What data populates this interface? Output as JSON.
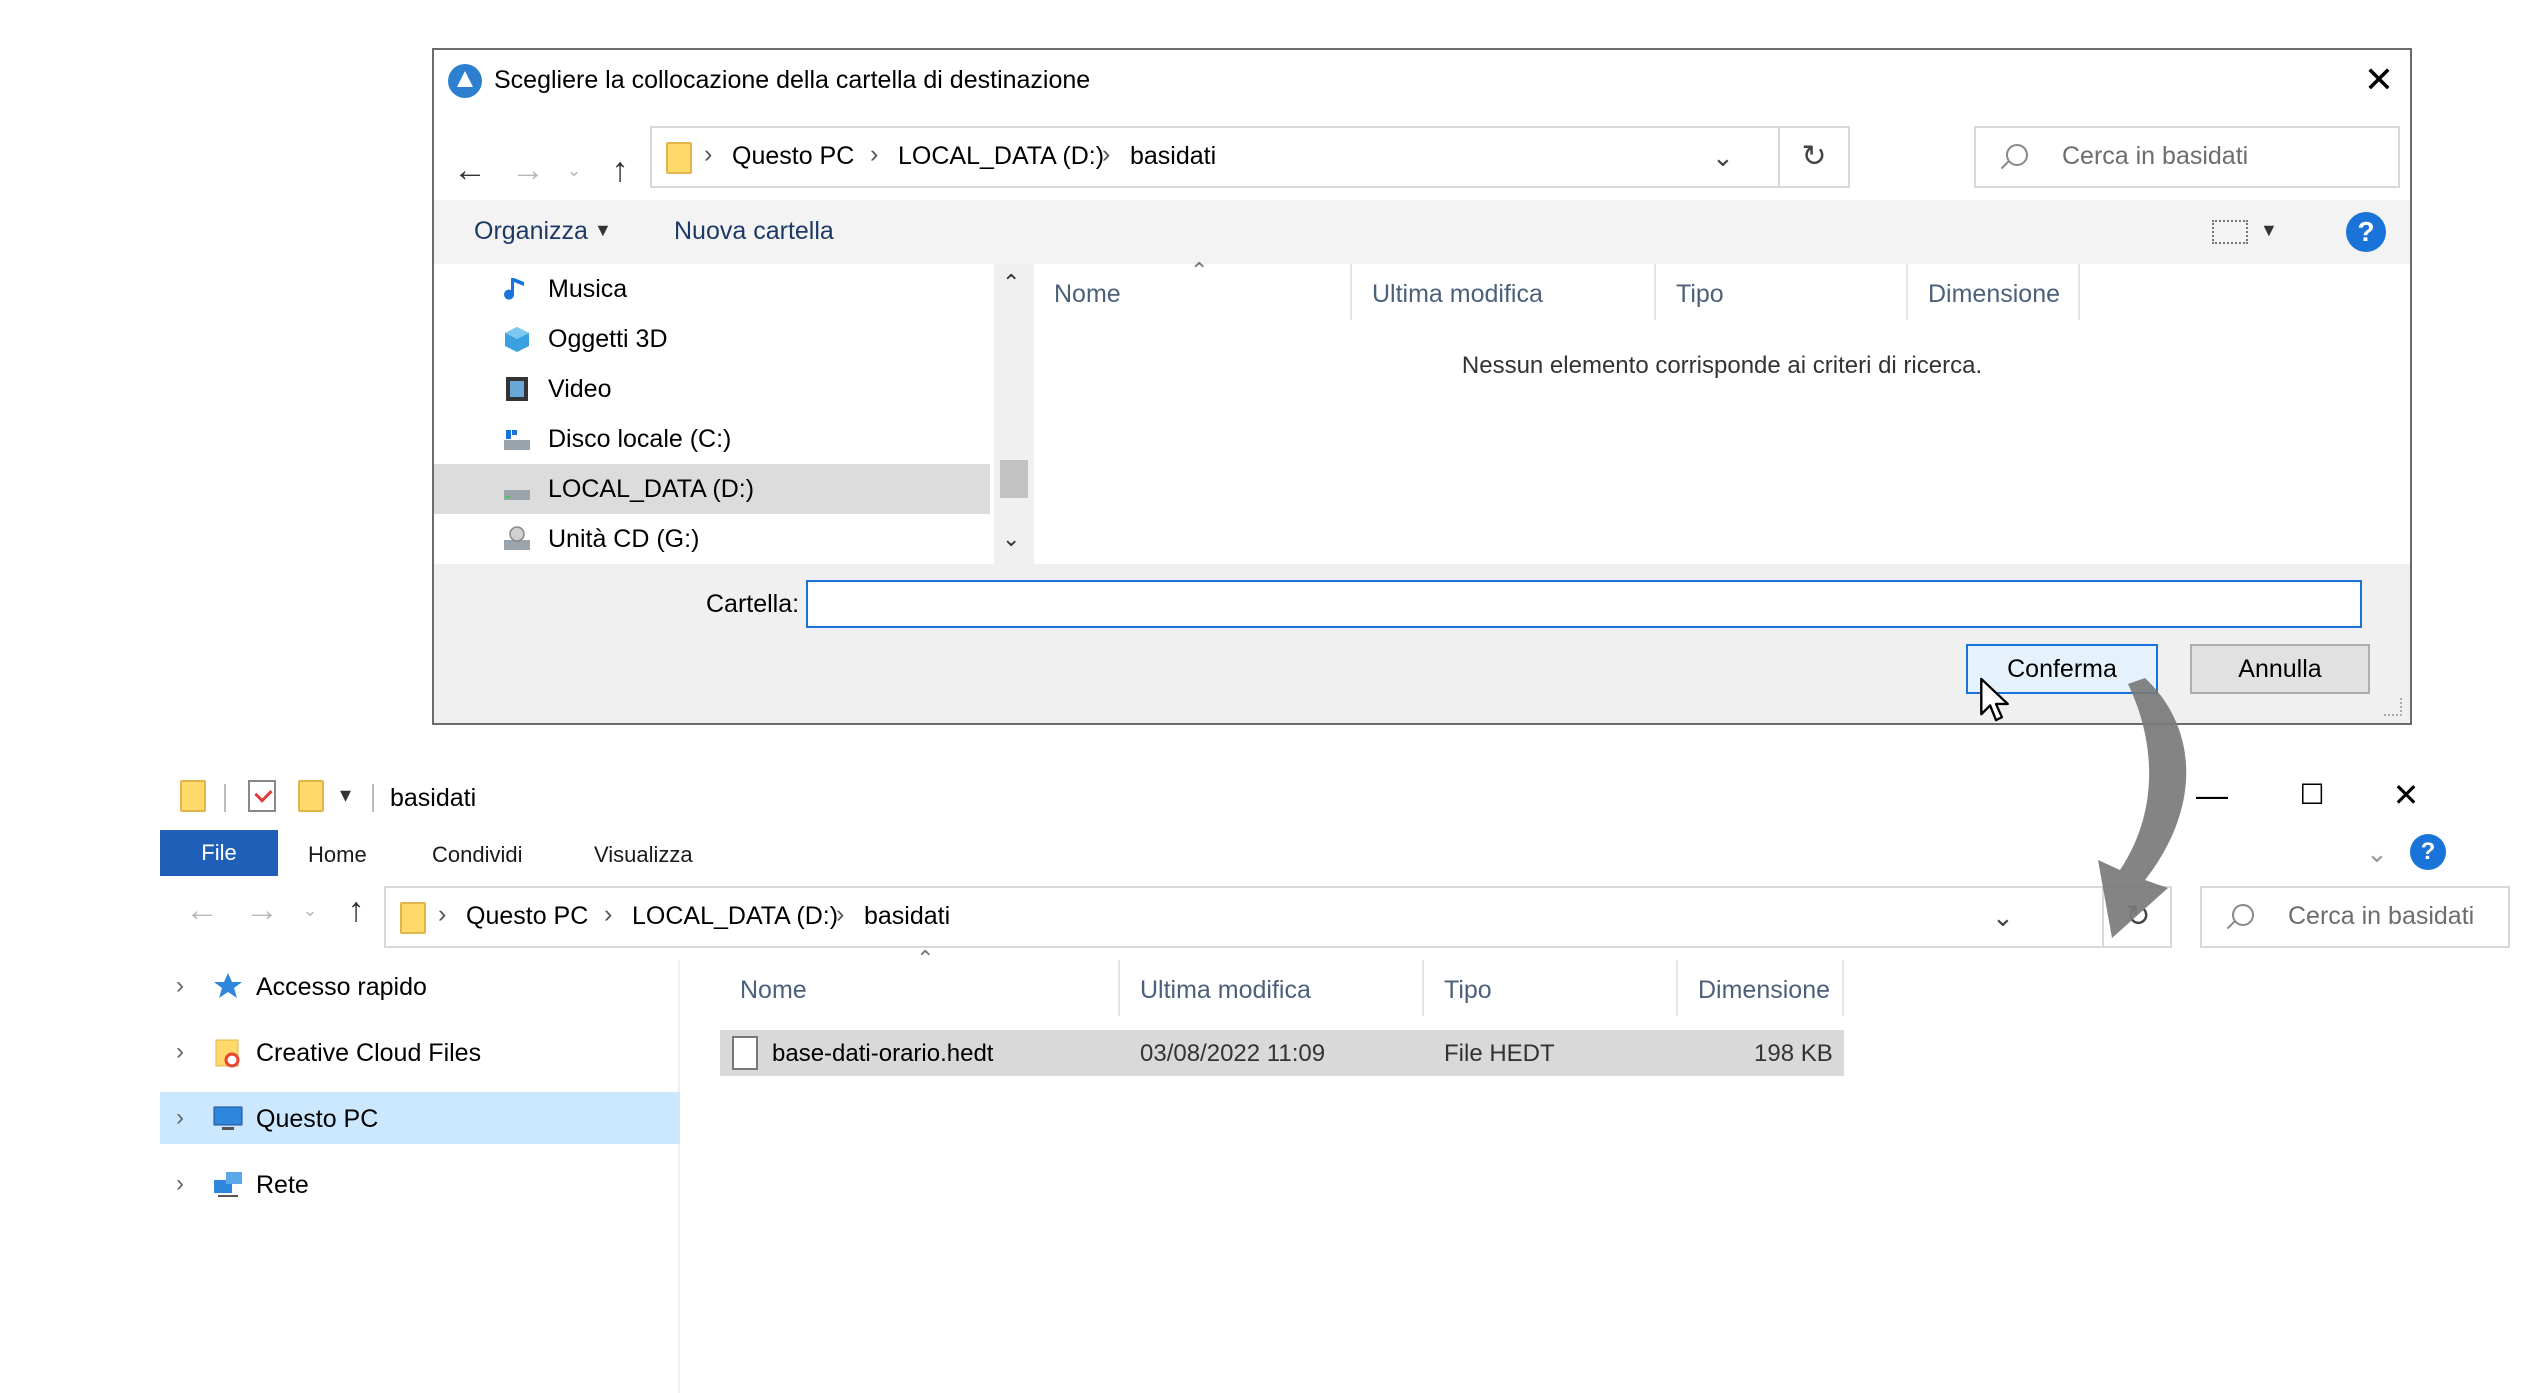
{
  "dialog": {
    "title": "Scegliere la collocazione della cartella di destinazione",
    "address": {
      "crumbs": [
        "Questo PC",
        "LOCAL_DATA (D:)",
        "basidati"
      ]
    },
    "search_placeholder": "Cerca in basidati",
    "toolbar": {
      "organize": "Organizza",
      "new_folder": "Nuova cartella",
      "help": "?"
    },
    "nav_items": [
      {
        "label": "Musica",
        "icon": "music-icon"
      },
      {
        "label": "Oggetti 3D",
        "icon": "3d-objects-icon"
      },
      {
        "label": "Video",
        "icon": "video-icon"
      },
      {
        "label": "Disco locale (C:)",
        "icon": "local-disk-icon"
      },
      {
        "label": "LOCAL_DATA (D:)",
        "icon": "drive-icon",
        "selected": true
      },
      {
        "label": "Unità CD (G:)",
        "icon": "cd-drive-icon"
      }
    ],
    "columns": [
      "Nome",
      "Ultima modifica",
      "Tipo",
      "Dimensione"
    ],
    "empty_message": "Nessun elemento corrisponde ai criteri di ricerca.",
    "folder_label": "Cartella:",
    "folder_value": "",
    "confirm_button": "Conferma",
    "cancel_button": "Annulla"
  },
  "explorer": {
    "title": "basidati",
    "ribbon_tabs": {
      "file": "File",
      "home": "Home",
      "share": "Condividi",
      "view": "Visualizza"
    },
    "help": "?",
    "address": {
      "crumbs": [
        "Questo PC",
        "LOCAL_DATA (D:)",
        "basidati"
      ]
    },
    "search_placeholder": "Cerca in basidati",
    "nav_items": [
      {
        "label": "Accesso rapido",
        "icon": "quick-access-star-icon"
      },
      {
        "label": "Creative Cloud Files",
        "icon": "creative-cloud-folder-icon"
      },
      {
        "label": "Questo PC",
        "icon": "computer-icon",
        "selected": true
      },
      {
        "label": "Rete",
        "icon": "network-icon"
      }
    ],
    "columns": [
      "Nome",
      "Ultima modifica",
      "Tipo",
      "Dimensione"
    ],
    "files": [
      {
        "name": "base-dati-orario.hedt",
        "modified": "03/08/2022 11:09",
        "type": "File HEDT",
        "size": "198 KB"
      }
    ]
  },
  "colors": {
    "accent": "#1a73d8",
    "selection": "#cce8ff",
    "folder": "#ffd969",
    "arrow": "#7a7a7a"
  }
}
